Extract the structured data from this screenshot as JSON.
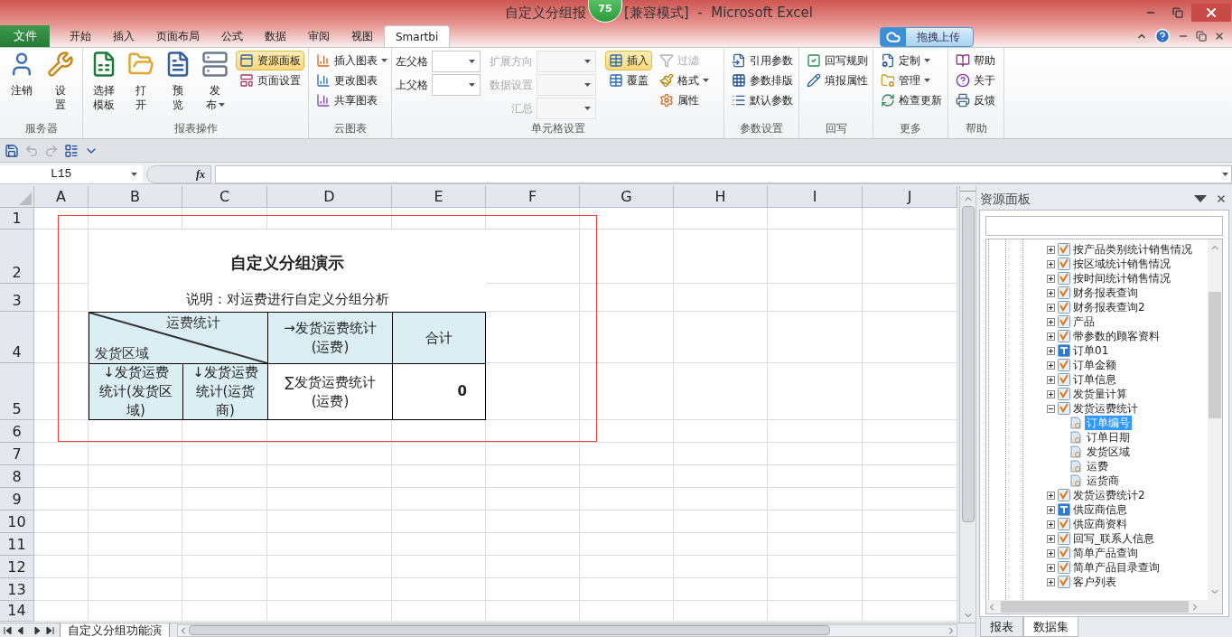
{
  "window": {
    "title": "自定义分组报",
    "badge": "75",
    "subtitle": "[兼容模式]  -  Microsoft Excel"
  },
  "menu_tabs": [
    {
      "label": "文件",
      "kind": "file",
      "selected": false
    },
    {
      "label": "开始",
      "kind": "tab",
      "selected": false
    },
    {
      "label": "插入",
      "kind": "tab",
      "selected": false
    },
    {
      "label": "页面布局",
      "kind": "tab",
      "selected": false
    },
    {
      "label": "公式",
      "kind": "tab",
      "selected": false
    },
    {
      "label": "数据",
      "kind": "tab",
      "selected": false
    },
    {
      "label": "审阅",
      "kind": "tab",
      "selected": false
    },
    {
      "label": "视图",
      "kind": "tab",
      "selected": false
    },
    {
      "label": "Smartbi",
      "kind": "tab",
      "selected": true
    }
  ],
  "upload_button": "拖拽上传",
  "ribbon": {
    "groups": [
      {
        "title": "服务器",
        "columns": [
          {
            "kind": "large",
            "items": [
              {
                "lines": [
                  "注销"
                ]
              }
            ]
          },
          {
            "kind": "large",
            "items": [
              {
                "lines": [
                  "设",
                  "置"
                ]
              }
            ]
          }
        ]
      },
      {
        "title": "报表操作",
        "columns": [
          {
            "kind": "large",
            "items": [
              {
                "lines": [
                  "选择",
                  "模板"
                ]
              }
            ]
          },
          {
            "kind": "large",
            "items": [
              {
                "lines": [
                  "打",
                  "开"
                ]
              }
            ]
          },
          {
            "kind": "large",
            "items": [
              {
                "lines": [
                  "预",
                  "览"
                ]
              }
            ]
          },
          {
            "kind": "large",
            "items": [
              {
                "lines": [
                  "发",
                  "布"
                ],
                "dropdown": true
              }
            ]
          },
          {
            "kind": "small",
            "items": [
              {
                "label": "资源面板",
                "selected": true,
                "disabled": false
              },
              {
                "label": "页面设置",
                "selected": false,
                "disabled": false
              }
            ]
          }
        ]
      },
      {
        "title": "云图表",
        "columns": [
          {
            "kind": "small",
            "items": [
              {
                "label": "插入图表",
                "selected": false,
                "disabled": false,
                "dropdown": true
              },
              {
                "label": "更改图表",
                "selected": false,
                "disabled": false
              },
              {
                "label": "共享图表",
                "selected": false,
                "disabled": false
              }
            ]
          }
        ]
      },
      {
        "title": "单元格设置",
        "columns": [
          {
            "kind": "combo",
            "items": [
              {
                "label": "左父格",
                "disabled": false
              },
              {
                "label": "上父格",
                "disabled": false
              }
            ]
          },
          {
            "kind": "combo",
            "items": [
              {
                "label": "扩展方向",
                "disabled": true
              },
              {
                "label": "数据设置",
                "disabled": true
              },
              {
                "label": "汇总",
                "disabled": true
              }
            ]
          },
          {
            "kind": "small",
            "items": [
              {
                "label": "插入",
                "selected": true,
                "disabled": false
              },
              {
                "label": "覆盖",
                "selected": false,
                "disabled": false
              }
            ]
          },
          {
            "kind": "small",
            "items": [
              {
                "label": "过滤",
                "selected": false,
                "disabled": true
              },
              {
                "label": "格式",
                "selected": false,
                "disabled": false,
                "dropdown": true
              },
              {
                "label": "属性",
                "selected": false,
                "disabled": false
              }
            ]
          }
        ]
      },
      {
        "title": "参数设置",
        "columns": [
          {
            "kind": "small",
            "items": [
              {
                "label": "引用参数",
                "selected": false,
                "disabled": false
              },
              {
                "label": "参数排版",
                "selected": false,
                "disabled": false
              },
              {
                "label": "默认参数",
                "selected": false,
                "disabled": false
              }
            ]
          }
        ]
      },
      {
        "title": "回写",
        "columns": [
          {
            "kind": "small",
            "items": [
              {
                "label": "回写规则",
                "selected": false,
                "disabled": false
              },
              {
                "label": "填报属性",
                "selected": false,
                "disabled": false
              }
            ]
          }
        ]
      },
      {
        "title": "更多",
        "columns": [
          {
            "kind": "small",
            "items": [
              {
                "label": "定制",
                "selected": false,
                "disabled": false,
                "dropdown": true
              },
              {
                "label": "管理",
                "selected": false,
                "disabled": false,
                "dropdown": true
              },
              {
                "label": "检查更新",
                "selected": false,
                "disabled": false
              }
            ]
          }
        ]
      },
      {
        "title": "帮助",
        "columns": [
          {
            "kind": "small",
            "items": [
              {
                "label": "帮助",
                "selected": false,
                "disabled": false
              },
              {
                "label": "关于",
                "selected": false,
                "disabled": false
              },
              {
                "label": "反馈",
                "selected": false,
                "disabled": false
              }
            ]
          }
        ]
      }
    ]
  },
  "quick_access": [
    {
      "kind": "save",
      "disabled": false
    },
    {
      "kind": "undo",
      "disabled": true
    },
    {
      "kind": "redo",
      "disabled": true
    },
    {
      "kind": "form",
      "disabled": false
    },
    {
      "kind": "customize",
      "disabled": false
    }
  ],
  "formula_bar": {
    "name_box": "L15",
    "function_button": "fx"
  },
  "sheet": {
    "columns": [
      "A",
      "B",
      "C",
      "D",
      "E",
      "F",
      "G",
      "H",
      "I",
      "J"
    ],
    "rows": [
      "1",
      "2",
      "3",
      "4",
      "5",
      "6",
      "7",
      "8",
      "9",
      "10",
      "11",
      "12",
      "13",
      "14"
    ],
    "title": "自定义分组演示",
    "note": "说明：对运费进行自定义分组分析",
    "table": {
      "corner_top": "运费统计",
      "corner_bottom": "发货区域",
      "header": [
        "→发货运费统计(运费)",
        "合计"
      ],
      "row": [
        "↓发货运费统计(发货区域)",
        "↓发货运费统计(运货商)",
        "∑发货运费统计(运费)",
        "0"
      ]
    }
  },
  "sheet_tabs": [
    {
      "label": "自定义分组功能演",
      "selected": true
    }
  ],
  "resource_panel": {
    "title": "资源面板",
    "tree": [
      {
        "label": "按产品类别统计销售情况",
        "kind": "query",
        "expanded": false
      },
      {
        "label": "按区域统计销售情况",
        "kind": "query",
        "expanded": false
      },
      {
        "label": "按时间统计销售情况",
        "kind": "query",
        "expanded": false
      },
      {
        "label": "财务报表查询",
        "kind": "query",
        "expanded": false
      },
      {
        "label": "财务报表查询2",
        "kind": "query",
        "expanded": false
      },
      {
        "label": "产品",
        "kind": "query",
        "expanded": false
      },
      {
        "label": "带参数的顾客资料",
        "kind": "query",
        "expanded": false
      },
      {
        "label": "订单01",
        "kind": "table",
        "expanded": false
      },
      {
        "label": "订单金额",
        "kind": "query",
        "expanded": false
      },
      {
        "label": "订单信息",
        "kind": "query",
        "expanded": false
      },
      {
        "label": "发货量计算",
        "kind": "query",
        "expanded": false
      },
      {
        "label": "发货运费统计",
        "kind": "query",
        "expanded": true,
        "children": [
          {
            "label": "订单编号",
            "selected": true
          },
          {
            "label": "订单日期",
            "selected": false
          },
          {
            "label": "发货区域",
            "selected": false
          },
          {
            "label": "运费",
            "selected": false
          },
          {
            "label": "运货商",
            "selected": false
          }
        ]
      },
      {
        "label": "发货运费统计2",
        "kind": "query",
        "expanded": false
      },
      {
        "label": "供应商信息",
        "kind": "table",
        "expanded": false
      },
      {
        "label": "供应商资料",
        "kind": "query",
        "expanded": false
      },
      {
        "label": "回写_联系人信息",
        "kind": "query",
        "expanded": false
      },
      {
        "label": "简单产品查询",
        "kind": "query",
        "expanded": false
      },
      {
        "label": "简单产品目录查询",
        "kind": "query",
        "expanded": false
      },
      {
        "label": "客户列表",
        "kind": "query",
        "expanded": false
      }
    ],
    "tabs": [
      {
        "label": "报表",
        "selected": false
      },
      {
        "label": "数据集",
        "selected": true
      }
    ]
  }
}
